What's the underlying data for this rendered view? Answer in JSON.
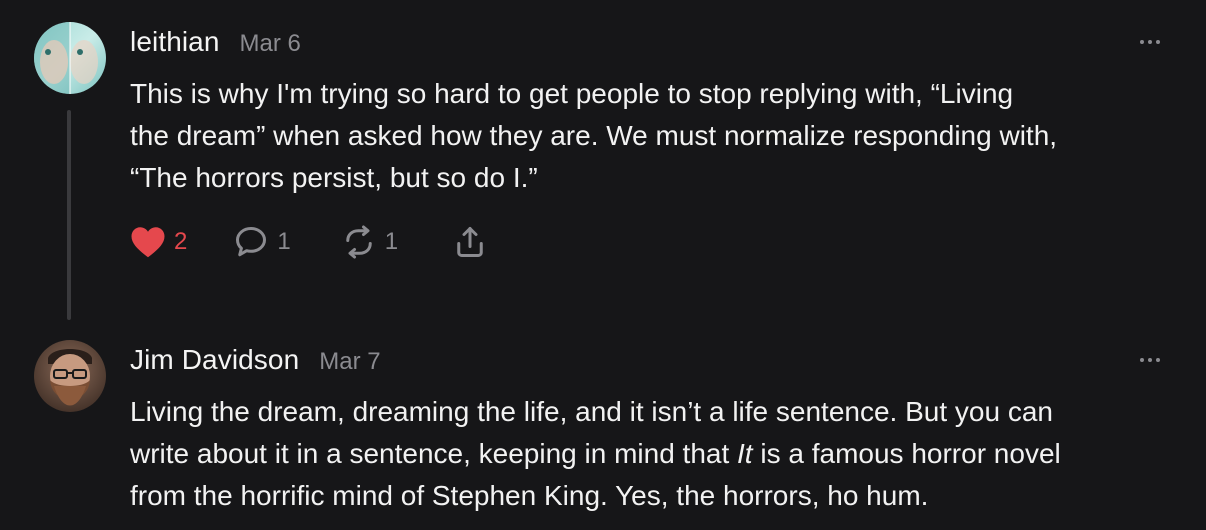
{
  "posts": [
    {
      "author": "leithian",
      "date": "Mar 6",
      "text": "This is why I'm trying so hard to get people to stop replying with, “Living\nthe dream” when asked how they are. We must normalize responding with,\n“The horrors persist, but so do I.”",
      "likes": "2",
      "replies": "1",
      "reposts": "1",
      "liked": true,
      "avatar_icon": "avatar-teal-face"
    },
    {
      "author": "Jim Davidson",
      "date": "Mar 7",
      "text_before_italic": "Living the dream, dreaming the life, and it isn’t a life sentence. But you can\nwrite about it in a sentence, keeping in mind that ",
      "text_italic": "It",
      "text_after_italic": " is a famous horror novel\nfrom the horrific mind of Stephen King. Yes, the horrors, ho hum.",
      "avatar_icon": "avatar-bearded-man"
    }
  ],
  "colors": {
    "background": "#161618",
    "text": "#f2f2f2",
    "muted": "#8b8b90",
    "like": "#e5484d",
    "thread_line": "#3a3a3d"
  },
  "icons": {
    "like": "heart-filled-icon",
    "reply": "speech-bubble-icon",
    "repost": "repost-arrows-icon",
    "share": "share-icon",
    "more": "ellipsis-icon"
  }
}
